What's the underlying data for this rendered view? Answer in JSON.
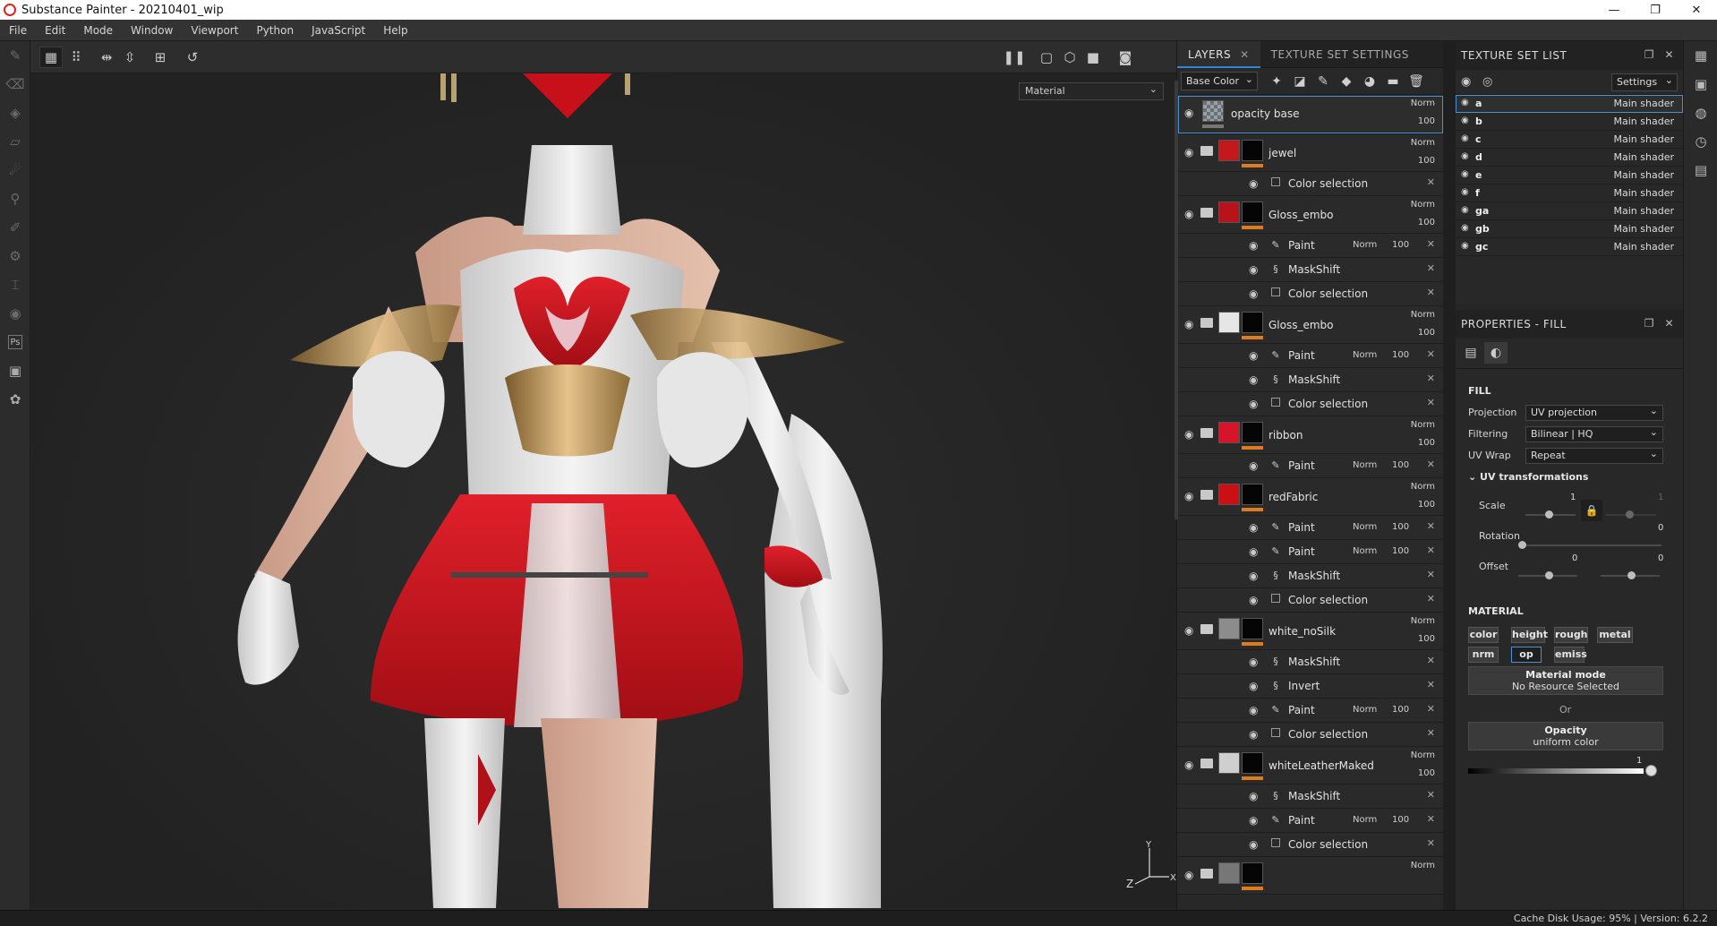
{
  "window": {
    "title": "Substance Painter - 20210401_wip",
    "minimize": "—",
    "maximize": "❐",
    "close": "✕"
  },
  "menu": [
    "File",
    "Edit",
    "Mode",
    "Window",
    "Viewport",
    "Python",
    "JavaScript",
    "Help"
  ],
  "viewport": {
    "mode_select": "Material",
    "axis": {
      "x": "X",
      "y": "Y",
      "z": "Z"
    }
  },
  "layers_panel": {
    "tab_layers": "LAYERS",
    "tab_texture_set_settings": "TEXTURE SET SETTINGS",
    "channel": "Base Color",
    "close": "✕",
    "layers": [
      {
        "name": "opacity base",
        "blend": "Norm",
        "opacity": "100",
        "thumb": "#7f8790",
        "folder": false,
        "selected": true,
        "subs": []
      },
      {
        "name": "jewel",
        "blend": "Norm",
        "opacity": "100",
        "thumb": "#c4181c",
        "folder": true,
        "subs": [
          {
            "icon": "check",
            "name": "Color selection",
            "blend": "",
            "opacity": ""
          }
        ]
      },
      {
        "name": "Gloss_embo",
        "blend": "Norm",
        "opacity": "100",
        "thumb": "#b8121a",
        "folder": true,
        "subs": [
          {
            "icon": "brush",
            "name": "Paint",
            "blend": "Norm",
            "opacity": "100"
          },
          {
            "icon": "gen",
            "name": "MaskShift",
            "blend": "",
            "opacity": ""
          },
          {
            "icon": "check",
            "name": "Color selection",
            "blend": "",
            "opacity": ""
          }
        ]
      },
      {
        "name": "Gloss_embo",
        "blend": "Norm",
        "opacity": "100",
        "thumb": "#e6e6e6",
        "folder": true,
        "subs": [
          {
            "icon": "brush",
            "name": "Paint",
            "blend": "Norm",
            "opacity": "100"
          },
          {
            "icon": "gen",
            "name": "MaskShift",
            "blend": "",
            "opacity": ""
          },
          {
            "icon": "check",
            "name": "Color selection",
            "blend": "",
            "opacity": ""
          }
        ]
      },
      {
        "name": "ribbon",
        "blend": "Norm",
        "opacity": "100",
        "thumb": "#d8142a",
        "folder": true,
        "subs": [
          {
            "icon": "brush",
            "name": "Paint",
            "blend": "Norm",
            "opacity": "100"
          }
        ]
      },
      {
        "name": "redFabric",
        "blend": "Norm",
        "opacity": "100",
        "thumb": "#cc0f12",
        "folder": true,
        "subs": [
          {
            "icon": "brush",
            "name": "Paint",
            "blend": "Norm",
            "opacity": "100"
          },
          {
            "icon": "brush",
            "name": "Paint",
            "blend": "Norm",
            "opacity": "100"
          },
          {
            "icon": "gen",
            "name": "MaskShift",
            "blend": "",
            "opacity": ""
          },
          {
            "icon": "check",
            "name": "Color selection",
            "blend": "",
            "opacity": ""
          }
        ]
      },
      {
        "name": "white_noSilk",
        "blend": "Norm",
        "opacity": "100",
        "thumb": "#8c8c8c",
        "folder": true,
        "subs": [
          {
            "icon": "gen",
            "name": "MaskShift",
            "blend": "",
            "opacity": ""
          },
          {
            "icon": "gen",
            "name": "Invert",
            "blend": "",
            "opacity": ""
          },
          {
            "icon": "brush",
            "name": "Paint",
            "blend": "Norm",
            "opacity": "100"
          },
          {
            "icon": "check",
            "name": "Color selection",
            "blend": "",
            "opacity": ""
          }
        ]
      },
      {
        "name": "whiteLeatherMaked",
        "blend": "Norm",
        "opacity": "100",
        "thumb": "#cfcfcf",
        "folder": true,
        "subs": [
          {
            "icon": "gen",
            "name": "MaskShift",
            "blend": "",
            "opacity": ""
          },
          {
            "icon": "brush",
            "name": "Paint",
            "blend": "Norm",
            "opacity": "100"
          },
          {
            "icon": "check",
            "name": "Color selection",
            "blend": "",
            "opacity": ""
          }
        ]
      },
      {
        "name": "",
        "blend": "Norm",
        "opacity": "",
        "thumb": "#777777",
        "folder": true,
        "subs": []
      }
    ]
  },
  "texture_set_list": {
    "title": "TEXTURE SET LIST",
    "settings": "Settings",
    "items": [
      {
        "name": "a",
        "shader": "Main shader",
        "selected": true
      },
      {
        "name": "b",
        "shader": "Main shader"
      },
      {
        "name": "c",
        "shader": "Main shader"
      },
      {
        "name": "d",
        "shader": "Main shader"
      },
      {
        "name": "e",
        "shader": "Main shader"
      },
      {
        "name": "f",
        "shader": "Main shader"
      },
      {
        "name": "ga",
        "shader": "Main shader"
      },
      {
        "name": "gb",
        "shader": "Main shader"
      },
      {
        "name": "gc",
        "shader": "Main shader"
      }
    ]
  },
  "properties": {
    "title": "PROPERTIES - FILL",
    "fill_section": "FILL",
    "projection_label": "Projection",
    "projection": "UV projection",
    "filtering_label": "Filtering",
    "filtering": "Bilinear | HQ",
    "uvwrap_label": "UV Wrap",
    "uvwrap": "Repeat",
    "uvtrans": "UV transformations",
    "scale_label": "Scale",
    "scale_a": "1",
    "scale_b": "1",
    "rotation_label": "Rotation",
    "rotation": "0",
    "offset_label": "Offset",
    "offset_a": "0",
    "offset_b": "0",
    "material_section": "MATERIAL",
    "channels": [
      "color",
      "height",
      "rough",
      "metal",
      "nrm",
      "op",
      "emiss"
    ],
    "active_channel": "op",
    "material_mode": "Material mode",
    "no_resource": "No Resource Selected",
    "or": "Or",
    "opacity_title": "Opacity",
    "opacity_mode": "uniform color",
    "opacity_value": "1"
  },
  "status": "Cache Disk Usage:   95% | Version: 6.2.2"
}
